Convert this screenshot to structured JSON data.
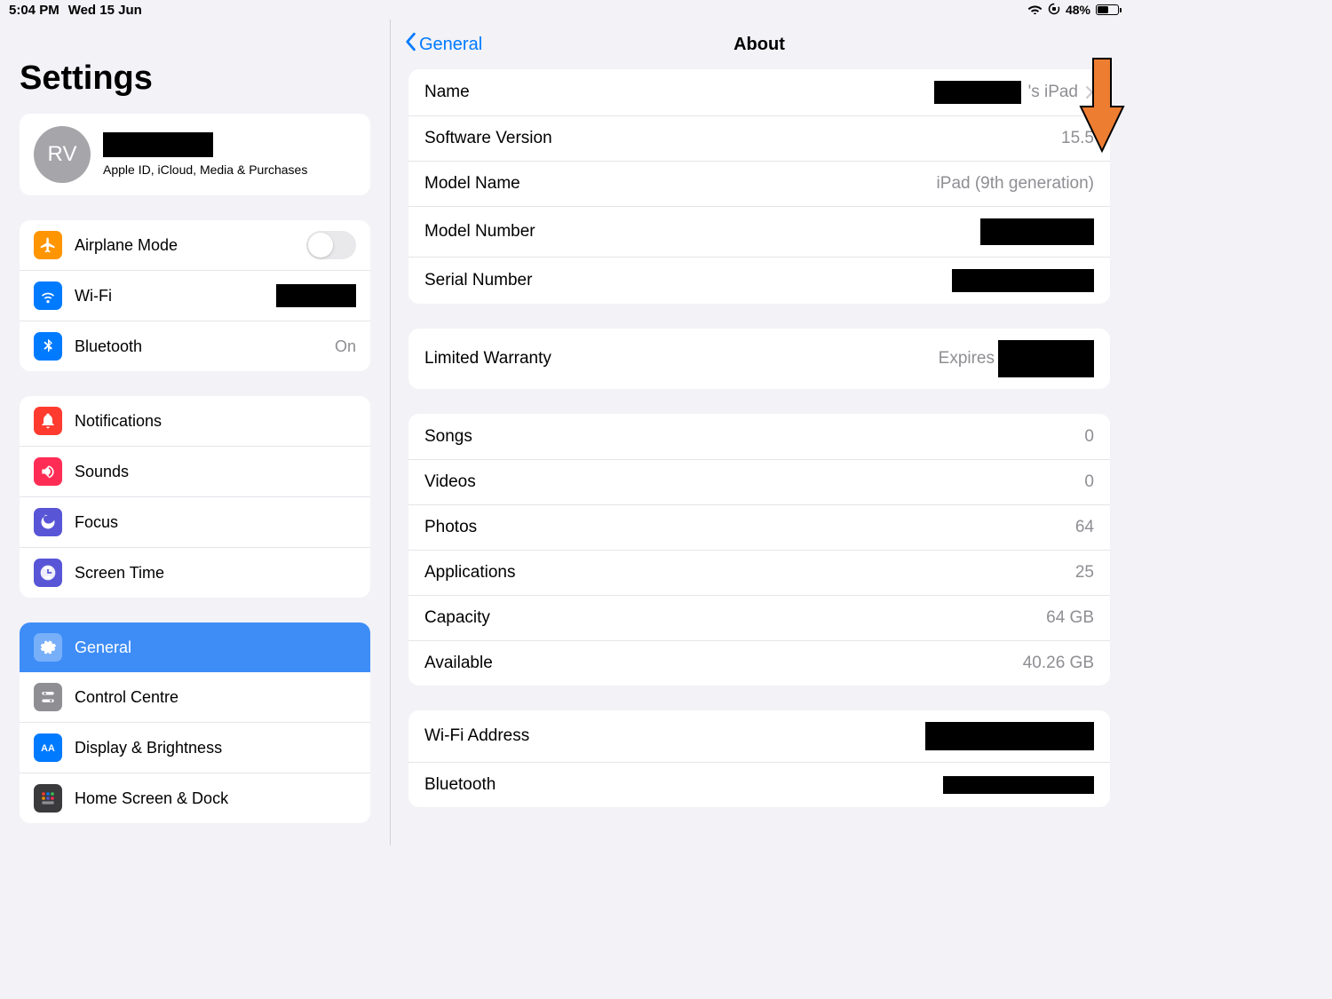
{
  "status": {
    "time": "5:04 PM",
    "date": "Wed 15 Jun",
    "battery_pct": "48%"
  },
  "sidebar": {
    "title": "Settings",
    "profile": {
      "initials": "RV",
      "sub": "Apple ID, iCloud, Media & Purchases"
    },
    "group1": {
      "airplane": "Airplane Mode",
      "wifi": "Wi-Fi",
      "bluetooth": "Bluetooth",
      "bluetooth_value": "On"
    },
    "group2": {
      "notifications": "Notifications",
      "sounds": "Sounds",
      "focus": "Focus",
      "screentime": "Screen Time"
    },
    "group3": {
      "general": "General",
      "control": "Control Centre",
      "display": "Display & Brightness",
      "home": "Home Screen & Dock"
    }
  },
  "detail": {
    "back_label": "General",
    "title": "About",
    "section1": {
      "name_label": "Name",
      "name_suffix": "'s iPad",
      "software_label": "Software Version",
      "software_value": "15.5",
      "model_name_label": "Model Name",
      "model_name_value": "iPad (9th generation)",
      "model_number_label": "Model Number",
      "serial_label": "Serial Number"
    },
    "section2": {
      "warranty_label": "Limited Warranty",
      "warranty_prefix": "Expires"
    },
    "section3": {
      "songs_label": "Songs",
      "songs_value": "0",
      "videos_label": "Videos",
      "videos_value": "0",
      "photos_label": "Photos",
      "photos_value": "64",
      "apps_label": "Applications",
      "apps_value": "25",
      "capacity_label": "Capacity",
      "capacity_value": "64 GB",
      "available_label": "Available",
      "available_value": "40.26 GB"
    },
    "section4": {
      "wifi_addr_label": "Wi-Fi Address",
      "bluetooth_label": "Bluetooth"
    }
  }
}
